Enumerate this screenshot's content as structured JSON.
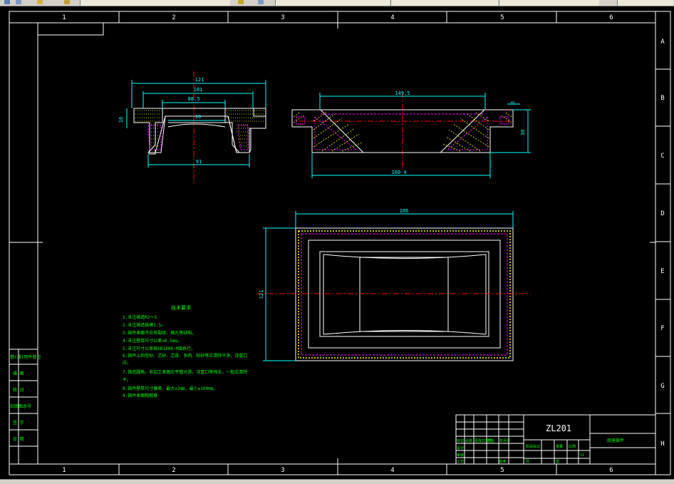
{
  "window": {
    "toolbar_icons": [
      "layer-icon",
      "properties-icon",
      "color-icon"
    ],
    "tabs": [
      "",
      "",
      "",
      ""
    ]
  },
  "border": {
    "col_labels": [
      "1",
      "2",
      "3",
      "4",
      "5",
      "6"
    ],
    "row_labels": [
      "A",
      "B",
      "C",
      "D",
      "E",
      "F",
      "G",
      "H"
    ]
  },
  "dims": {
    "top_left_121": "121",
    "top_left_101": "101",
    "top_left_88": "88.5",
    "top_left_16": "16",
    "top_left_10": "10",
    "top_left_91": "91",
    "top_right_149": "149.5",
    "top_right_3": "3",
    "top_right_30": "30",
    "top_right_160": "160-4",
    "plan_186": "186",
    "plan_121": "121"
  },
  "notes": {
    "title": "技术要求",
    "lines": [
      "1.未注铸造R2～5",
      "2.未注铸造拔模1.5。",
      "3.铸件表面不应有裂纹、缩孔等缺陷。",
      "4.未注壁厚尺寸公差±0.5mm。",
      "5.未注尺寸公差按GB1804-M级执行。",
      "6.铸件上的型砂、芯砂、芯骨、多肉、粘砂等应清除干净，浇冒口",
      "应。",
      "7.铸造圆角，非加工表面应平整光滑，浇冒口等残余，一般应清除",
      "干。",
      "8.铸件壁厚尺寸偏差，最大±2mm，最小≥100mm。",
      "9.铸件表面粗糙度"
    ]
  },
  "left_strip": {
    "cells": [
      "借(通)用件登记",
      "描  图",
      "校  对",
      "旧底图总号",
      "签  字",
      "日  期"
    ]
  },
  "title_block": {
    "drawing_no": "ZL201",
    "name": "底座铸件",
    "scale_label": "比例",
    "sheet_label": "第 张",
    "qty": "11",
    "small_cells": [
      "标记",
      "处数",
      "分区",
      "更改文件号",
      "签名",
      "年月日",
      "设计",
      "审核",
      "工艺",
      "批准",
      "阶段标记",
      "重量",
      "比例",
      "共",
      "张"
    ]
  },
  "colors": {
    "frame": "#ffffff",
    "dim": "#00ffff",
    "outline": "#ffffff",
    "hatch": "#ffff00",
    "center": "#ff0000",
    "hidden": "#ff00ff",
    "note": "#00ff00"
  }
}
